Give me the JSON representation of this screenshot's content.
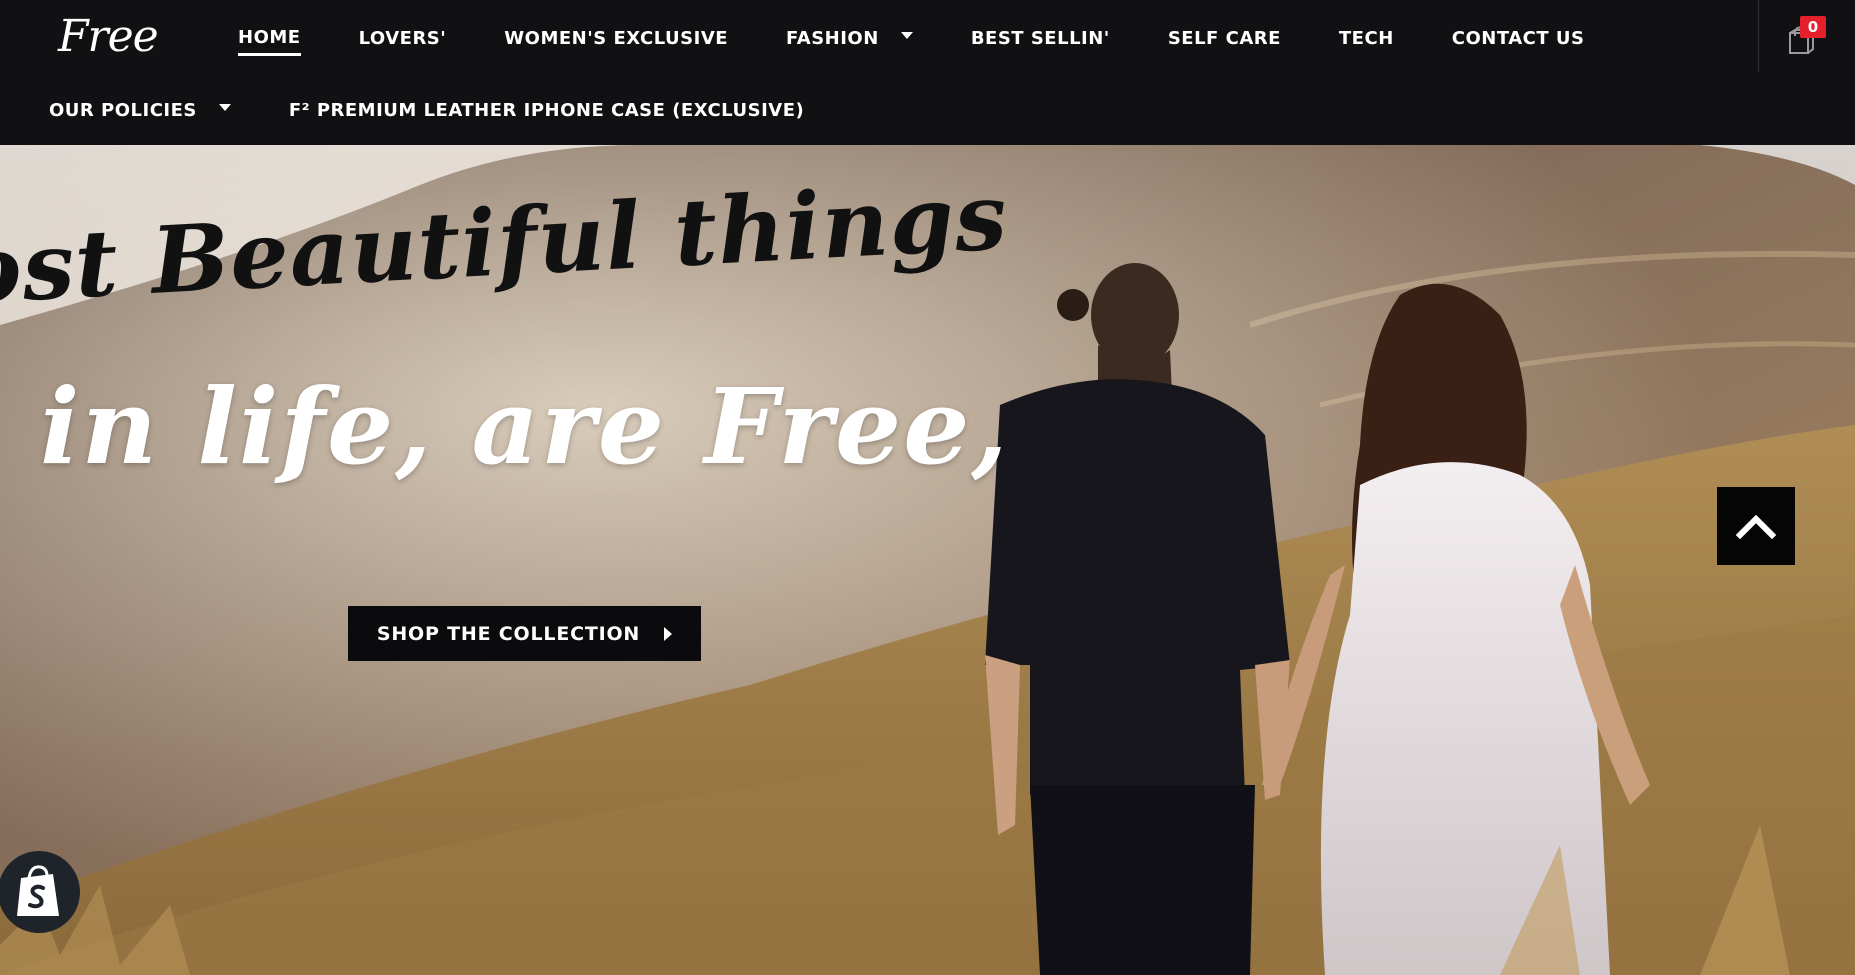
{
  "header": {
    "logo_text": "Free",
    "nav_primary": [
      {
        "label": "HOME",
        "active": true,
        "dropdown": false
      },
      {
        "label": "LOVERS'",
        "active": false,
        "dropdown": false
      },
      {
        "label": "WOMEN'S EXCLUSIVE",
        "active": false,
        "dropdown": false
      },
      {
        "label": "FASHION",
        "active": false,
        "dropdown": true
      },
      {
        "label": "BEST SELLIN'",
        "active": false,
        "dropdown": false
      },
      {
        "label": "SELF CARE",
        "active": false,
        "dropdown": false
      },
      {
        "label": "TECH",
        "active": false,
        "dropdown": false
      },
      {
        "label": "CONTACT US",
        "active": false,
        "dropdown": false
      }
    ],
    "nav_secondary": [
      {
        "label": "OUR POLICIES",
        "dropdown": true
      },
      {
        "label": "F² PREMIUM LEATHER IPHONE CASE (EXCLUSIVE)",
        "dropdown": false
      }
    ],
    "cart": {
      "icon": "shopping-bag-icon",
      "count": "0"
    }
  },
  "hero": {
    "headline_line1": "ost Beautiful things",
    "headline_line2": "in life, are Free,",
    "cta_label": "SHOP THE COLLECTION",
    "cta_icon": "play-arrow-icon"
  },
  "widgets": {
    "scroll_top_icon": "chevron-up-icon",
    "shopify_icon": "shopify-bag-icon"
  },
  "colors": {
    "header_bg": "#111114",
    "text_on_dark": "#ffffff",
    "cart_badge": "#e5202c",
    "button_bg": "#0b0b0d"
  }
}
